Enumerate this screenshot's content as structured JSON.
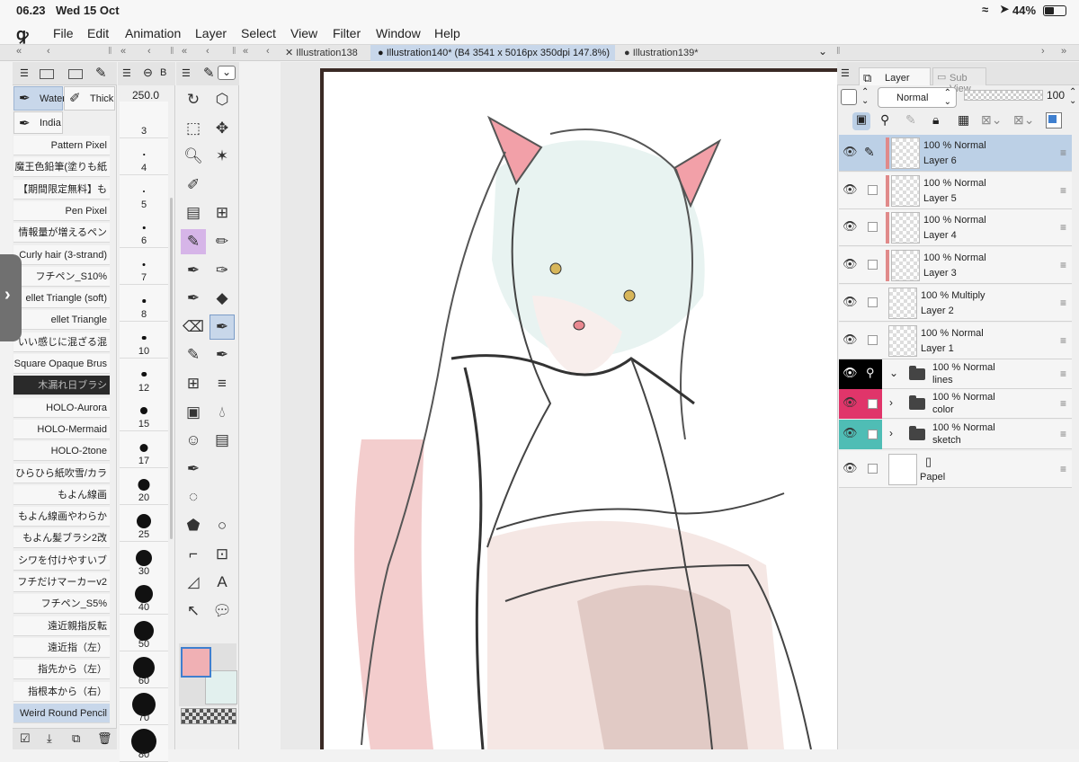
{
  "status": {
    "time": "06.23",
    "date": "Wed 15 Oct",
    "battery": "44%"
  },
  "menu": [
    "File",
    "Edit",
    "Animation",
    "Layer",
    "Select",
    "View",
    "Filter",
    "Window",
    "Help"
  ],
  "tabs": [
    {
      "label": "Illustration138",
      "active": false
    },
    {
      "label": "Illustration140* (B4 3541 x 5016px 350dpi 147.8%)",
      "active": true
    },
    {
      "label": "Illustration139*",
      "active": false
    }
  ],
  "subtool_tabs": [
    "Water",
    "Thick",
    "India"
  ],
  "brushes": [
    "Pattern Pixel",
    "魔王色鉛筆(塗りも紙",
    "【期間限定無料】も",
    "Pen Pixel",
    "情報量が増えるペン",
    "Curly hair (3-strand)",
    "フチペン_S10%",
    "ellet Triangle (soft)",
    "ellet Triangle",
    "いい感じに混ざる混",
    "Square Opaque Brus",
    "木漏れ日ブラシ",
    "HOLO-Aurora",
    "HOLO-Mermaid",
    "HOLO-2tone",
    "ひらひら紙吹雪/カラ",
    "もよん線画",
    "もよん線画やわらか",
    "もよん髪ブラシ2改",
    "シワを付けやすいブ",
    "フチだけマーカーv2",
    "フチペン_S5%",
    "遠近親指反転",
    "遠近指（左）",
    "指先から（左）",
    "指根本から（右）",
    "Weird Round Pencil"
  ],
  "brush_size": {
    "value": "250.0",
    "sizes": [
      "3",
      "4",
      "5",
      "6",
      "7",
      "8",
      "10",
      "12",
      "15",
      "17",
      "20",
      "25",
      "30",
      "40",
      "50",
      "60",
      "70",
      "80"
    ]
  },
  "sizes_dot": [
    1,
    1.5,
    2,
    2.5,
    3,
    3.5,
    4.5,
    5.5,
    8,
    9,
    13,
    16,
    18,
    20,
    22,
    24,
    26,
    28
  ],
  "layer_panel": {
    "tab_layer": "Layer",
    "tab_subview": "Sub View",
    "blend": "Normal",
    "opacity": "100",
    "layers": [
      {
        "mode": "100 %  Normal",
        "name": "Layer 6",
        "selected": true,
        "redbar": true,
        "type": "raster"
      },
      {
        "mode": "100 %  Normal",
        "name": "Layer 5",
        "selected": false,
        "redbar": true,
        "type": "raster"
      },
      {
        "mode": "100 %  Normal",
        "name": "Layer 4",
        "selected": false,
        "redbar": true,
        "type": "raster"
      },
      {
        "mode": "100 %  Normal",
        "name": "Layer 3",
        "selected": false,
        "redbar": true,
        "type": "raster"
      },
      {
        "mode": "100 %  Multiply",
        "name": "Layer 2",
        "selected": false,
        "redbar": false,
        "type": "raster"
      },
      {
        "mode": "100 %  Normal",
        "name": "Layer 1",
        "selected": false,
        "redbar": false,
        "type": "raster"
      },
      {
        "mode": "100 %  Normal",
        "name": "lines",
        "selected": false,
        "redbar": false,
        "type": "folder",
        "color": "#000000",
        "expanded": true
      },
      {
        "mode": "100 %  Normal",
        "name": "color",
        "selected": false,
        "redbar": false,
        "type": "folder",
        "color": "#e0356a",
        "expanded": false
      },
      {
        "mode": "100 %  Normal",
        "name": "sketch",
        "selected": false,
        "redbar": false,
        "type": "folder",
        "color": "#4fbdb5",
        "expanded": false
      },
      {
        "mode": "",
        "name": "Papel",
        "selected": false,
        "redbar": false,
        "type": "paper"
      }
    ]
  },
  "colors": {
    "main": "#f0b0b4",
    "sub": "#e2f0ee",
    "accent": "#3f7fcf"
  }
}
